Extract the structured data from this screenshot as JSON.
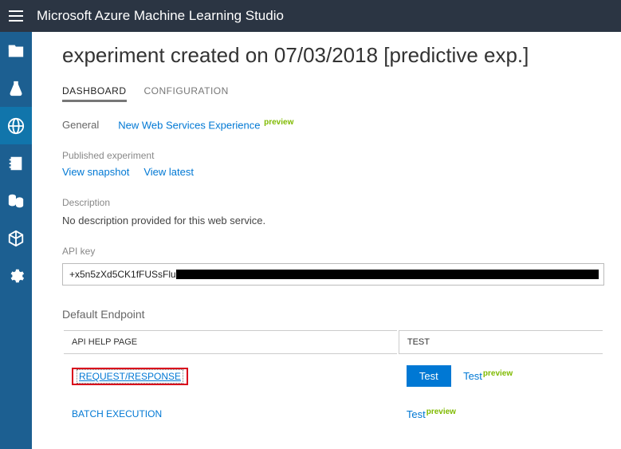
{
  "header": {
    "app_title": "Microsoft Azure Machine Learning Studio"
  },
  "page": {
    "title": "experiment created on 07/03/2018 [predictive exp.]",
    "tabs": [
      "DASHBOARD",
      "CONFIGURATION"
    ],
    "subnav": {
      "general": "General",
      "new_ws": "New Web Services Experience",
      "preview": "preview"
    },
    "published": {
      "label": "Published experiment",
      "snapshot": "View snapshot",
      "latest": "View latest"
    },
    "description": {
      "label": "Description",
      "text": "No description provided for this web service."
    },
    "api": {
      "label": "API key",
      "value_visible": "+x5n5zXd5CK1fFUSsFlu"
    },
    "endpoint": {
      "title": "Default Endpoint",
      "cols": [
        "API HELP PAGE",
        "TEST"
      ],
      "rows": [
        {
          "name": "REQUEST/RESPONSE",
          "btn": "Test",
          "link": "Test",
          "preview": "preview"
        },
        {
          "name": "BATCH EXECUTION",
          "btn": "",
          "link": "Test",
          "preview": "preview"
        }
      ]
    }
  }
}
